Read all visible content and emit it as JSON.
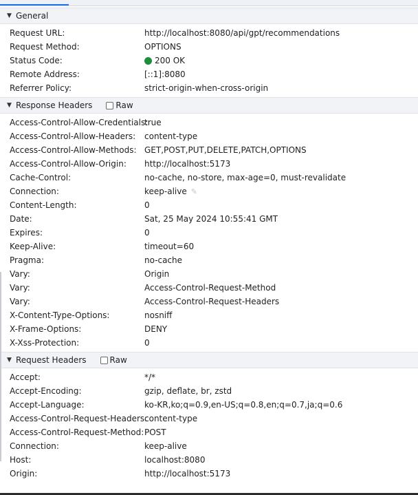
{
  "general": {
    "title": "General",
    "rows": [
      {
        "key": "Request URL:",
        "value": "http://localhost:8080/api/gpt/recommendations"
      },
      {
        "key": "Request Method:",
        "value": "OPTIONS"
      },
      {
        "key": "Status Code:",
        "value": "200 OK",
        "status_color": "#1e8e3e"
      },
      {
        "key": "Remote Address:",
        "value": "[::1]:8080"
      },
      {
        "key": "Referrer Policy:",
        "value": "strict-origin-when-cross-origin"
      }
    ]
  },
  "response_headers": {
    "title": "Response Headers",
    "raw_label": "Raw",
    "rows": [
      {
        "key": "Access-Control-Allow-Credentials:",
        "value": "true"
      },
      {
        "key": "Access-Control-Allow-Headers:",
        "value": "content-type"
      },
      {
        "key": "Access-Control-Allow-Methods:",
        "value": "GET,POST,PUT,DELETE,PATCH,OPTIONS"
      },
      {
        "key": "Access-Control-Allow-Origin:",
        "value": "http://localhost:5173"
      },
      {
        "key": "Cache-Control:",
        "value": "no-cache, no-store, max-age=0, must-revalidate"
      },
      {
        "key": "Connection:",
        "value": "keep-alive"
      },
      {
        "key": "Content-Length:",
        "value": "0"
      },
      {
        "key": "Date:",
        "value": "Sat, 25 May 2024 10:55:41 GMT"
      },
      {
        "key": "Expires:",
        "value": "0"
      },
      {
        "key": "Keep-Alive:",
        "value": "timeout=60"
      },
      {
        "key": "Pragma:",
        "value": "no-cache"
      },
      {
        "key": "Vary:",
        "value": "Origin"
      },
      {
        "key": "Vary:",
        "value": "Access-Control-Request-Method"
      },
      {
        "key": "Vary:",
        "value": "Access-Control-Request-Headers"
      },
      {
        "key": "X-Content-Type-Options:",
        "value": "nosniff"
      },
      {
        "key": "X-Frame-Options:",
        "value": "DENY"
      },
      {
        "key": "X-Xss-Protection:",
        "value": "0"
      }
    ]
  },
  "request_headers": {
    "title": "Request Headers",
    "raw_label": "Raw",
    "rows": [
      {
        "key": "Accept:",
        "value": "*/*"
      },
      {
        "key": "Accept-Encoding:",
        "value": "gzip, deflate, br, zstd"
      },
      {
        "key": "Accept-Language:",
        "value": "ko-KR,ko;q=0.9,en-US;q=0.8,en;q=0.7,ja;q=0.6"
      },
      {
        "key": "Access-Control-Request-Headers:",
        "value": "content-type"
      },
      {
        "key": "Access-Control-Request-Method:",
        "value": "POST"
      },
      {
        "key": "Connection:",
        "value": "keep-alive"
      },
      {
        "key": "Host:",
        "value": "localhost:8080"
      },
      {
        "key": "Origin:",
        "value": "http://localhost:5173"
      }
    ]
  },
  "icons": {
    "expand": "triangle-down-icon",
    "edit": "pencil-icon",
    "status": "status-dot-icon"
  },
  "colors": {
    "accent": "#1a73e8",
    "status_ok": "#1e8e3e",
    "section_bg": "#f1f3f6"
  }
}
